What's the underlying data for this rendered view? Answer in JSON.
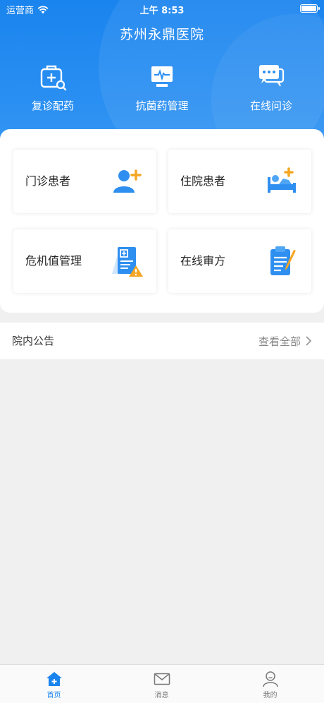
{
  "status_bar": {
    "carrier": "运营商",
    "time": "上午 8:53"
  },
  "header": {
    "title": "苏州永鼎医院"
  },
  "quick_actions": [
    {
      "label": "复诊配药",
      "icon": "medical-kit-icon"
    },
    {
      "label": "抗菌药管理",
      "icon": "monitor-pulse-icon"
    },
    {
      "label": "在线问诊",
      "icon": "chat-bubbles-icon"
    }
  ],
  "cards": [
    {
      "label": "门诊患者",
      "icon": "add-patient-icon"
    },
    {
      "label": "住院患者",
      "icon": "hospital-bed-icon"
    },
    {
      "label": "危机值管理",
      "icon": "warning-report-icon"
    },
    {
      "label": "在线审方",
      "icon": "clipboard-pen-icon"
    }
  ],
  "notice": {
    "title": "院内公告",
    "more": "查看全部"
  },
  "tabs": [
    {
      "label": "首页",
      "icon": "home-icon",
      "active": true
    },
    {
      "label": "消息",
      "icon": "mail-icon",
      "active": false
    },
    {
      "label": "我的",
      "icon": "user-icon",
      "active": false
    }
  ],
  "colors": {
    "primary": "#1a84ee",
    "accent_orange": "#f5a623",
    "background": "#f0f0f0"
  }
}
